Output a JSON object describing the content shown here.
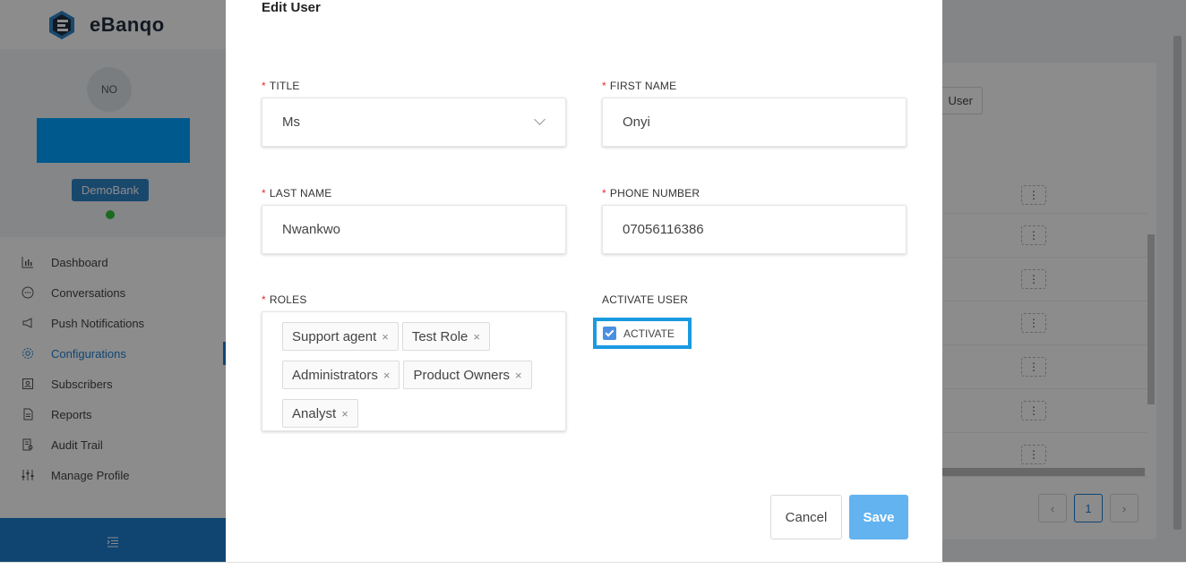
{
  "app": {
    "brand": "eBanqo",
    "user_initials": "NO",
    "bank_badge": "DemoBank",
    "nav": [
      {
        "label": "Dashboard",
        "icon": "bar-chart-icon"
      },
      {
        "label": "Conversations",
        "icon": "chat-icon"
      },
      {
        "label": "Push Notifications",
        "icon": "megaphone-icon"
      },
      {
        "label": "Configurations",
        "icon": "gear-icon",
        "active": true
      },
      {
        "label": "Subscribers",
        "icon": "contact-card-icon"
      },
      {
        "label": "Reports",
        "icon": "document-icon"
      },
      {
        "label": "Audit Trail",
        "icon": "audit-icon"
      },
      {
        "label": "Manage Profile",
        "icon": "sliders-icon"
      }
    ],
    "add_user_label": "User",
    "pager_current": "1",
    "colors": {
      "accent": "#1e7fd0",
      "badge": "#2e83c6",
      "online": "#34c23a",
      "name_block": "#00a2ff"
    }
  },
  "modal": {
    "title": "Edit User",
    "title_field": {
      "label": "TITLE",
      "value": "Ms"
    },
    "first_name": {
      "label": "FIRST NAME",
      "value": "Onyi"
    },
    "last_name": {
      "label": "LAST NAME",
      "value": "Nwankwo"
    },
    "phone": {
      "label": "PHONE NUMBER",
      "value": "07056116386"
    },
    "roles": {
      "label": "ROLES",
      "items": [
        "Support agent",
        "Test Role",
        "Administrators",
        "Product Owners",
        "Analyst"
      ],
      "remove_glyph": "×"
    },
    "activate": {
      "label": "ACTIVATE USER",
      "checkbox_label": "ACTIVATE",
      "checked": true
    },
    "cancel_label": "Cancel",
    "save_label": "Save",
    "colors": {
      "required": "#e03030",
      "save": "#62b3f0",
      "highlight": "#1a9ae0"
    }
  }
}
